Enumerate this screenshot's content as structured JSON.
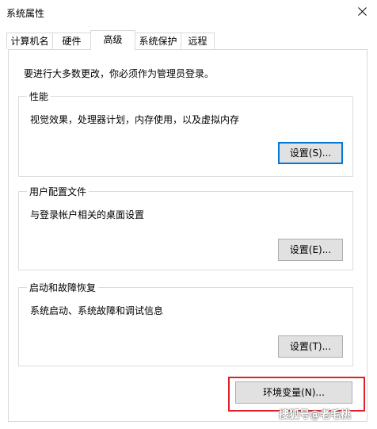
{
  "window": {
    "title": "系统属性"
  },
  "tabs": [
    {
      "label": "计算机名",
      "active": false
    },
    {
      "label": "硬件",
      "active": false
    },
    {
      "label": "高级",
      "active": true
    },
    {
      "label": "系统保护",
      "active": false
    },
    {
      "label": "远程",
      "active": false
    }
  ],
  "intro_text": "要进行大多数更改，你必须作为管理员登录。",
  "groups": {
    "performance": {
      "title": "性能",
      "description": "视觉效果，处理器计划，内存使用，以及虚拟内存",
      "button_label": "设置(S)..."
    },
    "user_profiles": {
      "title": "用户配置文件",
      "description": "与登录帐户相关的桌面设置",
      "button_label": "设置(E)..."
    },
    "startup_recovery": {
      "title": "启动和故障恢复",
      "description": "系统启动、系统故障和调试信息",
      "button_label": "设置(T)..."
    }
  },
  "env_button_label": "环境变量(N)...",
  "watermark": "搜狐号@老毛桃",
  "colors": {
    "focus_border": "#0078d7",
    "highlight_border": "#e0212b",
    "button_bg": "#e1e1e1"
  }
}
